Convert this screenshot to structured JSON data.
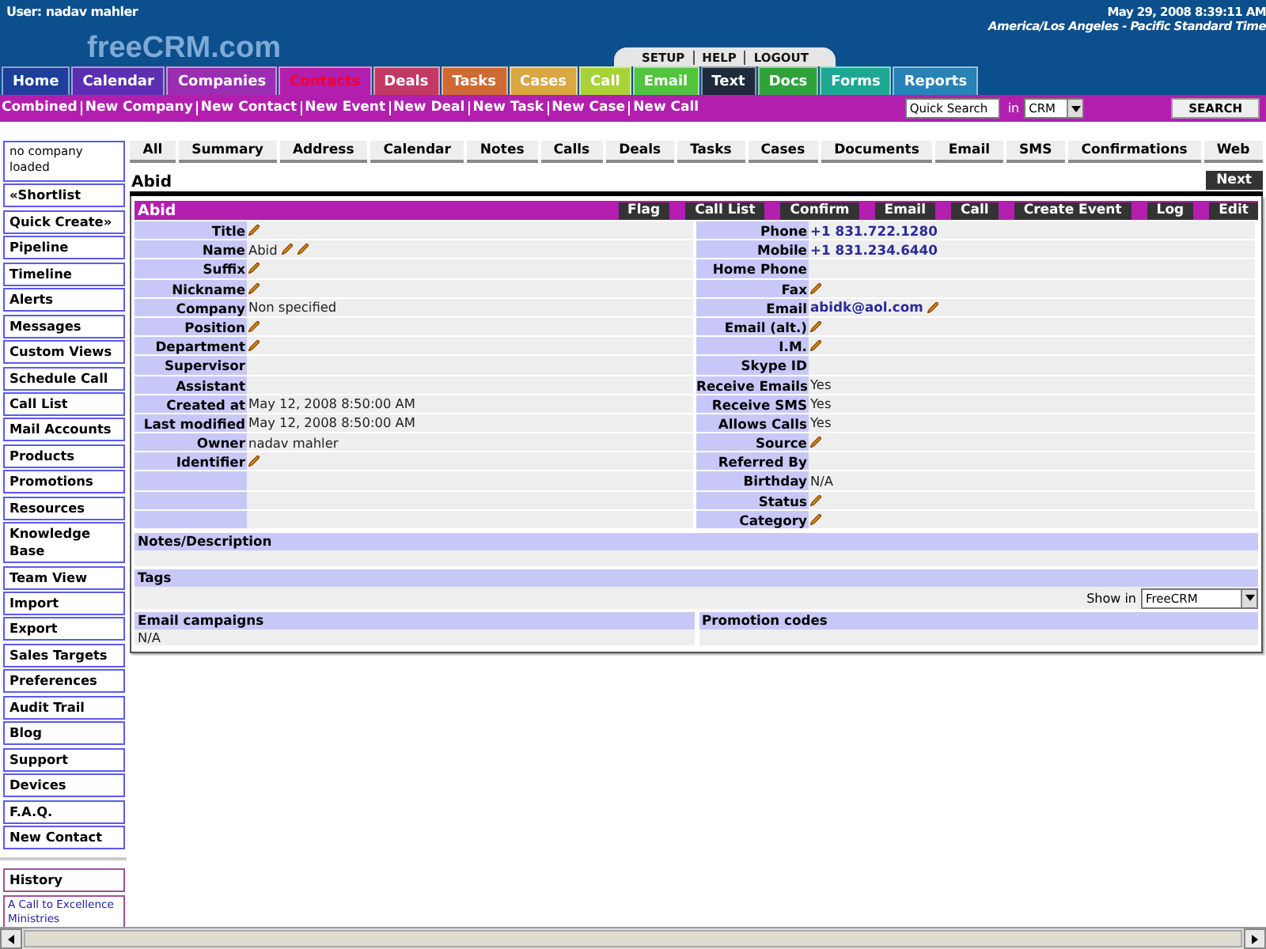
{
  "header": {
    "user": "User: nadav mahler",
    "logo": "freeCRM.com",
    "datetime": "May 29, 2008 8:39:11 AM",
    "timezone": "America/Los Angeles - Pacific Standard Time",
    "util_links": [
      "SETUP",
      "HELP",
      "LOGOUT"
    ]
  },
  "nav_tabs": [
    {
      "label": "Home",
      "color": "#1c3f9c",
      "selected": false
    },
    {
      "label": "Calendar",
      "color": "#5b2fb3",
      "selected": false
    },
    {
      "label": "Companies",
      "color": "#9b2db3",
      "selected": false
    },
    {
      "label": "Contacts",
      "color": "#b21fae",
      "selected": true
    },
    {
      "label": "Deals",
      "color": "#c23a63",
      "selected": false
    },
    {
      "label": "Tasks",
      "color": "#cf6a33",
      "selected": false
    },
    {
      "label": "Cases",
      "color": "#d9a842",
      "selected": false
    },
    {
      "label": "Call",
      "color": "#a8d23a",
      "selected": false
    },
    {
      "label": "Email",
      "color": "#52c43e",
      "selected": false
    },
    {
      "label": "Text",
      "color": "#1e2b3c",
      "selected": false
    },
    {
      "label": "Docs",
      "color": "#2fa33a",
      "selected": false
    },
    {
      "label": "Forms",
      "color": "#1ea792",
      "selected": false
    },
    {
      "label": "Reports",
      "color": "#2782b5",
      "selected": false
    }
  ],
  "quick_links": [
    "Combined",
    "New Company",
    "New Contact",
    "New Event",
    "New Deal",
    "New Task",
    "New Case",
    "New Call"
  ],
  "search": {
    "placeholder": "Quick Search",
    "in_label": "in",
    "scope": "CRM",
    "button": "SEARCH"
  },
  "sidebar": {
    "company_note": "no company loaded",
    "items": [
      "«Shortlist",
      "Quick Create»",
      "Pipeline",
      "Timeline",
      "Alerts",
      "Messages",
      "Custom Views",
      "Schedule Call",
      "Call List",
      "Mail Accounts",
      "Products",
      "Promotions",
      "Resources",
      "Knowledge Base",
      "Team View",
      "Import",
      "Export",
      "Sales Targets",
      "Preferences",
      "Audit Trail",
      "Blog",
      "Support",
      "Devices",
      "F.A.Q.",
      "New Contact"
    ],
    "history_title": "History",
    "history_items": [
      "A Call to Excellence Ministries"
    ]
  },
  "sub_tabs": [
    "All",
    "Summary",
    "Address",
    "Calendar",
    "Notes",
    "Calls",
    "Deals",
    "Tasks",
    "Cases",
    "Documents",
    "Email",
    "SMS",
    "Confirmations",
    "Web"
  ],
  "record": {
    "title": "Abid",
    "next": "Next",
    "name": "Abid",
    "actions": [
      "Flag",
      "Call List",
      "Confirm",
      "Email",
      "Call",
      "Create Event",
      "Log",
      "Edit"
    ]
  },
  "left_fields": [
    {
      "label": "Title",
      "edit_icons": [
        {
          "kind": "pencil"
        }
      ]
    },
    {
      "label": "Name",
      "kind": "text",
      "value": "Abid",
      "edit_icons": [
        {
          "kind": "pencil"
        },
        {
          "kind": "pencil"
        }
      ]
    },
    {
      "label": "Suffix",
      "edit_icons": [
        {
          "kind": "pencil"
        }
      ]
    },
    {
      "label": "Nickname",
      "edit_icons": [
        {
          "kind": "pencil"
        }
      ]
    },
    {
      "label": "Company",
      "kind": "text",
      "value": "Non specified"
    },
    {
      "label": "Position",
      "edit_icons": [
        {
          "kind": "pencil"
        }
      ]
    },
    {
      "label": "Department",
      "edit_icons": [
        {
          "kind": "pencil"
        }
      ]
    },
    {
      "label": "Supervisor"
    },
    {
      "label": "Assistant"
    },
    {
      "label": "Created at",
      "kind": "text",
      "value": "May 12, 2008 8:50:00 AM"
    },
    {
      "label": "Last modified",
      "kind": "text",
      "value": "May 12, 2008 8:50:00 AM"
    },
    {
      "label": "Owner",
      "kind": "text",
      "value": "nadav mahler"
    },
    {
      "label": "Identifier",
      "edit_icons": [
        {
          "kind": "pencil"
        }
      ]
    }
  ],
  "right_fields": [
    {
      "label": "Phone",
      "kind": "link",
      "value": "+1 831.722.1280"
    },
    {
      "label": "Mobile",
      "kind": "link",
      "value": "+1 831.234.6440"
    },
    {
      "label": "Home Phone"
    },
    {
      "label": "Fax",
      "edit_icons": [
        {
          "kind": "pencil"
        }
      ]
    },
    {
      "label": "Email",
      "kind": "link",
      "value": "abidk@aol.com",
      "edit_icons": [
        {
          "kind": "pencil"
        }
      ]
    },
    {
      "label": "Email (alt.)",
      "edit_icons": [
        {
          "kind": "pencil"
        }
      ]
    },
    {
      "label": "I.M.",
      "edit_icons": [
        {
          "kind": "pencil"
        }
      ]
    },
    {
      "label": "Skype ID"
    },
    {
      "label": "Receive Emails",
      "kind": "text",
      "value": "Yes"
    },
    {
      "label": "Receive SMS",
      "kind": "text",
      "value": "Yes"
    },
    {
      "label": "Allows Calls",
      "kind": "text",
      "value": "Yes"
    },
    {
      "label": "Source",
      "edit_icons": [
        {
          "kind": "pencil"
        }
      ]
    },
    {
      "label": "Referred By"
    },
    {
      "label": "Birthday",
      "kind": "text",
      "value": "N/A"
    },
    {
      "label": "Status",
      "edit_icons": [
        {
          "kind": "pencil"
        }
      ]
    },
    {
      "label": "Category",
      "edit_icons": [
        {
          "kind": "pencil"
        }
      ]
    }
  ],
  "notes": {
    "title": "Notes/Description"
  },
  "tags": {
    "title": "Tags",
    "show_in_label": "Show in",
    "show_in_value": "FreeCRM"
  },
  "email_campaigns": {
    "title": "Email campaigns",
    "value": "N/A"
  },
  "promotion_codes": {
    "title": "Promotion codes"
  }
}
